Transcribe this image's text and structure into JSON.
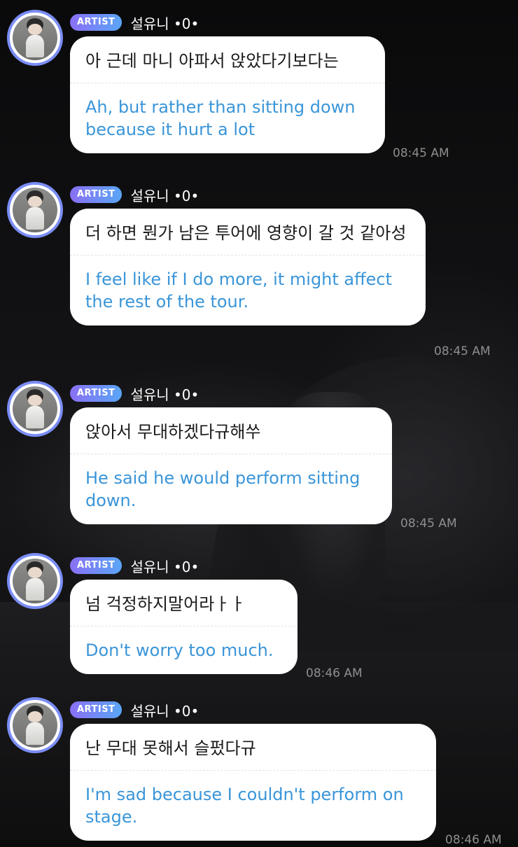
{
  "messages": [
    {
      "badge": "ARTIST",
      "name": "설유니 •0•",
      "original": "아 근데 마니 아파서 앉았다기보다는",
      "translation": "Ah, but rather than sitting down because it hurt a lot",
      "time": "08:45 AM"
    },
    {
      "badge": "ARTIST",
      "name": "설유니 •0•",
      "original": "더 하면 뭔가 남은 투어에 영향이 갈 것 같아성",
      "translation": "I feel like if I do more, it might affect the rest of the tour.",
      "time": "08:45 AM"
    },
    {
      "badge": "ARTIST",
      "name": "설유니 •0•",
      "original": "앉아서 무대하겠다규해쑤",
      "translation": "He said he would perform sitting down.",
      "time": "08:45 AM"
    },
    {
      "badge": "ARTIST",
      "name": "설유니 •0•",
      "original": "넘 걱정하지말어라ㅏㅏ",
      "translation": "Don't worry too much.",
      "time": "08:46 AM"
    },
    {
      "badge": "ARTIST",
      "name": "설유니 •0•",
      "original": "난 무대 못해서 슬펐다규",
      "translation": "I'm sad because I couldn't perform on stage.",
      "time": "08:46 AM"
    }
  ]
}
